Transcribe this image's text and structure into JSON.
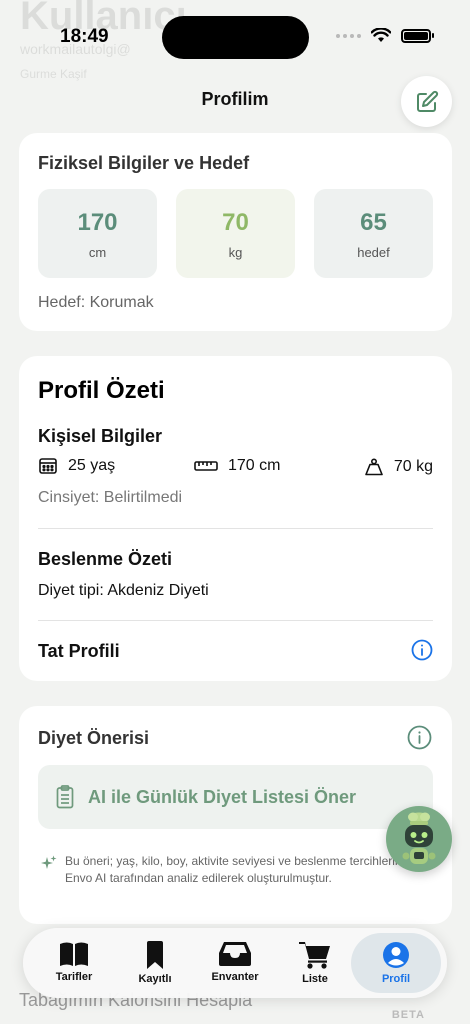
{
  "background_header": {
    "title": "Kullanıcı",
    "subtitle": "workmailautolgi@",
    "sub2": "Gurme Kaşif"
  },
  "status": {
    "time": "18:49"
  },
  "header": {
    "title": "Profilim",
    "edit_icon": "edit-icon"
  },
  "physical": {
    "title": "Fiziksel Bilgiler ve Hedef",
    "stats": [
      {
        "value": "170",
        "unit": "cm",
        "color": "#5b8d7a",
        "bg": "#eef1f0"
      },
      {
        "value": "70",
        "unit": "kg",
        "color": "#8fb866",
        "bg": "#f2f5ec"
      },
      {
        "value": "65",
        "unit": "hedef",
        "color": "#5b8d7a",
        "bg": "#eef1f0"
      }
    ],
    "goal": "Hedef: Korumak"
  },
  "summary": {
    "title": "Profil Özeti",
    "personal_title": "Kişisel Bilgiler",
    "age": "25 yaş",
    "height": "170 cm",
    "weight": "70 kg",
    "gender": "Cinsiyet: Belirtilmedi",
    "nutrition_title": "Beslenme Özeti",
    "diet_type": "Diyet tipi: Akdeniz Diyeti",
    "taste_title": "Tat Profili"
  },
  "diet": {
    "title": "Diyet Önerisi",
    "button": "AI ile Günlük Diyet Listesi Öner",
    "note": "Bu öneri; yaş, kilo, boy, aktivite seviyesi ve beslenme tercihleriniz Envo AI tarafından analiz edilerek oluşturulmuştur."
  },
  "underlying": {
    "text": "Tabağımın Kalorisini Hesapla",
    "badge": "BETA"
  },
  "tabs": [
    {
      "label": "Tarifler",
      "icon": "book-icon"
    },
    {
      "label": "Kayıtlı",
      "icon": "bookmark-icon"
    },
    {
      "label": "Envanter",
      "icon": "tray-icon"
    },
    {
      "label": "Liste",
      "icon": "cart-icon"
    },
    {
      "label": "Profil",
      "icon": "person-icon",
      "active": true
    }
  ],
  "colors": {
    "accent_green": "#6f9a7d",
    "active_blue": "#1a73e8"
  }
}
